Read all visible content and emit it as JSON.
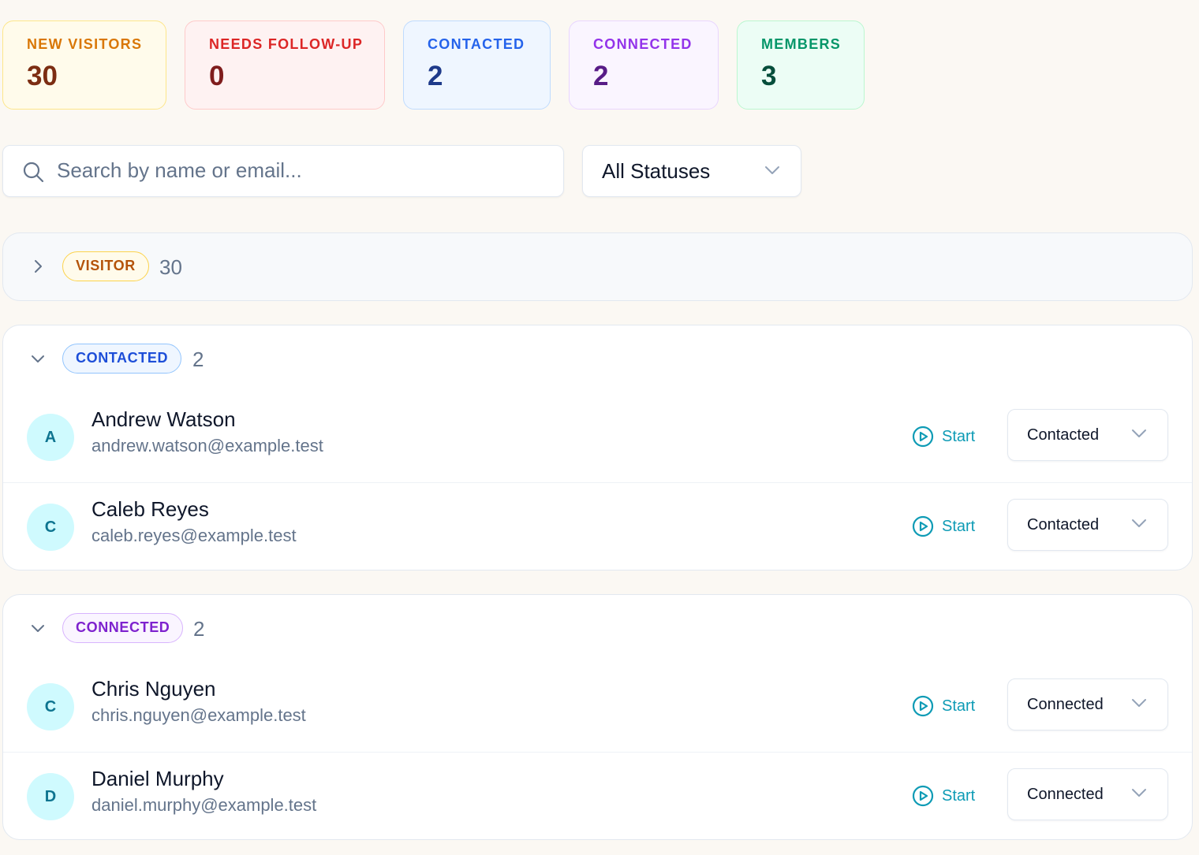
{
  "stats": [
    {
      "label": "NEW VISITORS",
      "value": "30",
      "colors": {
        "bg": "#fffbeb",
        "border": "#fde68a",
        "label": "#d97706",
        "value": "#7c2d12"
      }
    },
    {
      "label": "NEEDS FOLLOW-UP",
      "value": "0",
      "colors": {
        "bg": "#fef2f2",
        "border": "#fecaca",
        "label": "#dc2626",
        "value": "#7f1d1d"
      }
    },
    {
      "label": "CONTACTED",
      "value": "2",
      "colors": {
        "bg": "#eff6ff",
        "border": "#bfdbfe",
        "label": "#2563eb",
        "value": "#1e3a8a"
      }
    },
    {
      "label": "CONNECTED",
      "value": "2",
      "colors": {
        "bg": "#faf5ff",
        "border": "#e9d5ff",
        "label": "#9333ea",
        "value": "#581c87"
      }
    },
    {
      "label": "MEMBERS",
      "value": "3",
      "colors": {
        "bg": "#ecfdf5",
        "border": "#bbf7d0",
        "label": "#059669",
        "value": "#064e3b"
      }
    }
  ],
  "search": {
    "placeholder": "Search by name or email...",
    "icon": "search-icon"
  },
  "filter": {
    "selected": "All Statuses",
    "icon": "chevron-down-icon"
  },
  "groups": [
    {
      "label": "VISITOR",
      "count": "30",
      "expanded": false,
      "colors": {
        "bg": "#fffbeb",
        "border": "#fcd34d",
        "text": "#b45309"
      },
      "members": []
    },
    {
      "label": "CONTACTED",
      "count": "2",
      "expanded": true,
      "colors": {
        "bg": "#eff6ff",
        "border": "#93c5fd",
        "text": "#1d4ed8"
      },
      "members": [
        {
          "initial": "A",
          "name": "Andrew Watson",
          "email": "andrew.watson@example.test",
          "action": "Start",
          "status": "Contacted"
        },
        {
          "initial": "C",
          "name": "Caleb Reyes",
          "email": "caleb.reyes@example.test",
          "action": "Start",
          "status": "Contacted"
        }
      ]
    },
    {
      "label": "CONNECTED",
      "count": "2",
      "expanded": true,
      "colors": {
        "bg": "#faf5ff",
        "border": "#d8b4fe",
        "text": "#7e22ce"
      },
      "members": [
        {
          "initial": "C",
          "name": "Chris Nguyen",
          "email": "chris.nguyen@example.test",
          "action": "Start",
          "status": "Connected"
        },
        {
          "initial": "D",
          "name": "Daniel Murphy",
          "email": "daniel.murphy@example.test",
          "action": "Start",
          "status": "Connected"
        }
      ]
    }
  ],
  "accent": "#0e9bb5"
}
